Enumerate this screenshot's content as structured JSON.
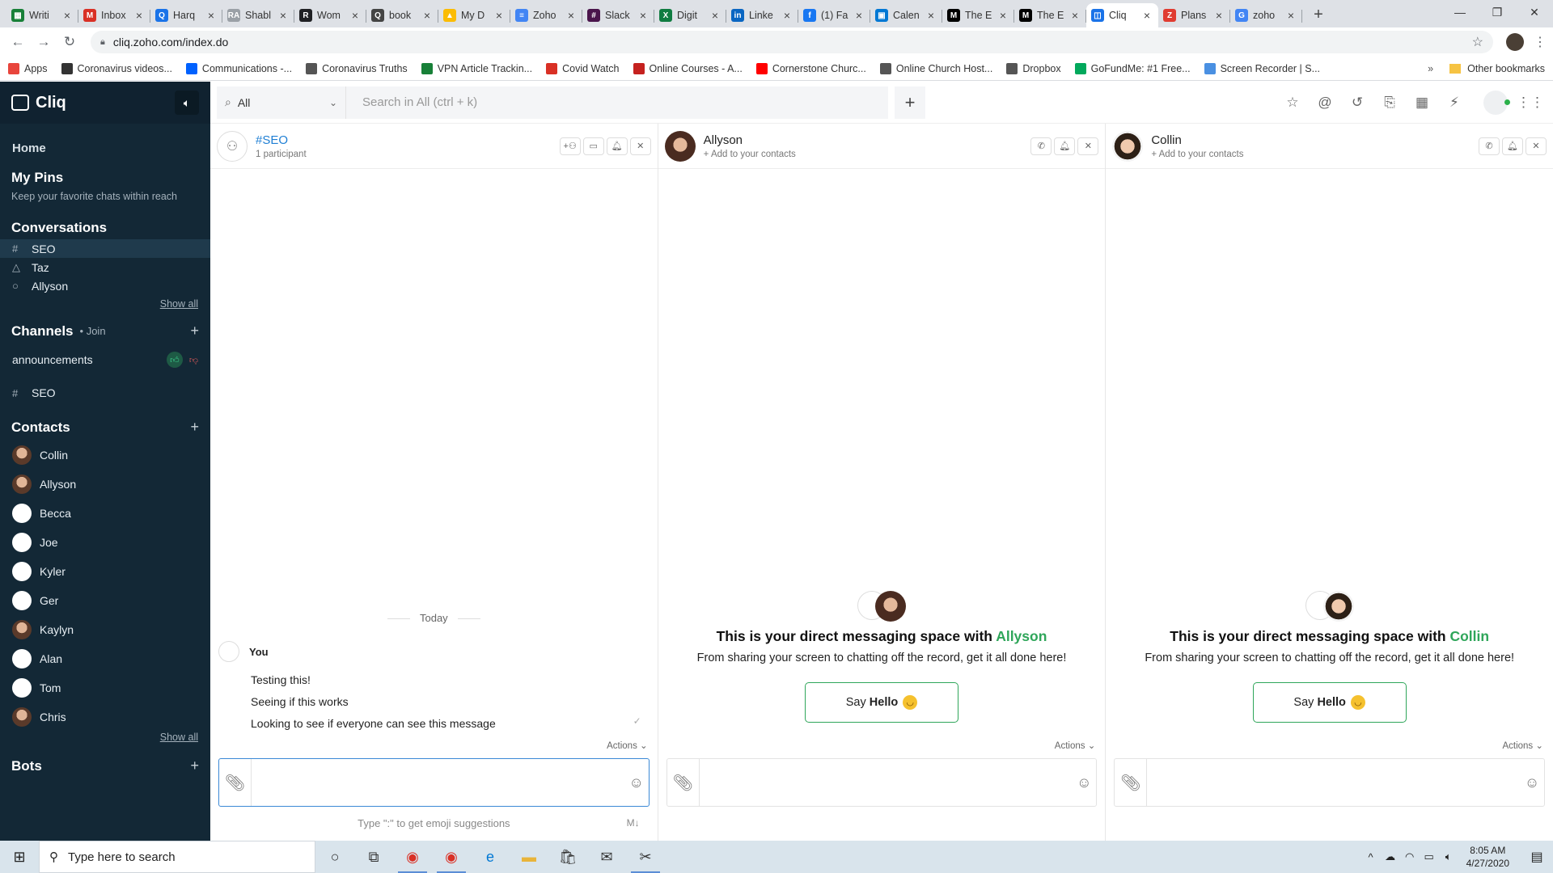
{
  "browser": {
    "tabs": [
      {
        "label": "Writi",
        "icon": "google-sheets-icon",
        "color": "#188038",
        "glyph": "▦",
        "active": false
      },
      {
        "label": "Inbox",
        "icon": "gmail-icon",
        "color": "#d93025",
        "glyph": "M",
        "active": false
      },
      {
        "label": "Harq",
        "icon": "search-icon",
        "color": "#1a73e8",
        "glyph": "Q",
        "active": false
      },
      {
        "label": "Shabl",
        "icon": "site-icon",
        "color": "#9aa0a6",
        "glyph": "RA",
        "active": false
      },
      {
        "label": "Wom",
        "icon": "r-logo-icon",
        "color": "#202124",
        "glyph": "R",
        "active": false
      },
      {
        "label": "book",
        "icon": "search-icon",
        "color": "#444444",
        "glyph": "Q",
        "active": false
      },
      {
        "label": "My D",
        "icon": "google-drive-icon",
        "color": "#fbbc04",
        "glyph": "▲",
        "active": false
      },
      {
        "label": "Zoho",
        "icon": "google-docs-icon",
        "color": "#4285f4",
        "glyph": "≡",
        "active": false
      },
      {
        "label": "Slack",
        "icon": "slack-icon",
        "color": "#4a154b",
        "glyph": "#",
        "active": false
      },
      {
        "label": "Digit",
        "icon": "excel-icon",
        "color": "#107c41",
        "glyph": "X",
        "active": false
      },
      {
        "label": "Linke",
        "icon": "linkedin-icon",
        "color": "#0a66c2",
        "glyph": "in",
        "active": false
      },
      {
        "label": "(1) Fa",
        "icon": "facebook-icon",
        "color": "#1877f2",
        "glyph": "f",
        "active": false
      },
      {
        "label": "Calen",
        "icon": "outlook-icon",
        "color": "#0078d4",
        "glyph": "▣",
        "active": false
      },
      {
        "label": "The E",
        "icon": "medium-icon",
        "color": "#000000",
        "glyph": "M",
        "active": false
      },
      {
        "label": "The E",
        "icon": "medium-icon",
        "color": "#000000",
        "glyph": "M",
        "active": false
      },
      {
        "label": "Cliq",
        "icon": "cliq-icon",
        "color": "#1a73e8",
        "glyph": "◫",
        "active": true
      },
      {
        "label": "Plans",
        "icon": "zoho-z-icon",
        "color": "#e03c31",
        "glyph": "Z",
        "active": false
      },
      {
        "label": "zoho",
        "icon": "google-icon",
        "color": "#4285f4",
        "glyph": "G",
        "active": false
      }
    ],
    "url": "cliq.zoho.com/index.do",
    "bookmarks": [
      {
        "label": "Apps",
        "color": "#e8453c"
      },
      {
        "label": "Coronavirus videos...",
        "color": "#333333"
      },
      {
        "label": "Communications -...",
        "color": "#0061fe"
      },
      {
        "label": "Coronavirus Truths",
        "color": "#555555"
      },
      {
        "label": "VPN Article Trackin...",
        "color": "#188038"
      },
      {
        "label": "Covid Watch",
        "color": "#d93025"
      },
      {
        "label": "Online Courses - A...",
        "color": "#c5221f"
      },
      {
        "label": "Cornerstone Churc...",
        "color": "#ff0000"
      },
      {
        "label": "Online Church Host...",
        "color": "#555555"
      },
      {
        "label": "Dropbox",
        "color": "#555555"
      },
      {
        "label": "GoFundMe: #1 Free...",
        "color": "#02a95c"
      },
      {
        "label": "Screen Recorder | S...",
        "color": "#4a90e2"
      }
    ],
    "other_bookmarks": "Other bookmarks"
  },
  "sidebar": {
    "app_name": "Cliq",
    "home": "Home",
    "pins_title": "My Pins",
    "pins_sub": "Keep your favorite chats within reach",
    "conversations_title": "Conversations",
    "conversations": [
      {
        "icon": "#",
        "label": "SEO",
        "selected": true
      },
      {
        "icon": "△",
        "label": "Taz",
        "selected": false
      },
      {
        "icon": "○",
        "label": "Allyson",
        "selected": false
      }
    ],
    "show_all": "Show all",
    "channels_title": "Channels",
    "channels_join": "• Join",
    "announcements": "announcements",
    "channel_seo": "SEO",
    "contacts_title": "Contacts",
    "contacts": [
      {
        "name": "Collin",
        "photo": true
      },
      {
        "name": "Allyson",
        "photo": true
      },
      {
        "name": "Becca",
        "photo": false
      },
      {
        "name": "Joe",
        "photo": false
      },
      {
        "name": "Kyler",
        "photo": false
      },
      {
        "name": "Ger",
        "photo": false
      },
      {
        "name": "Kaylyn",
        "photo": true
      },
      {
        "name": "Alan",
        "photo": false
      },
      {
        "name": "Tom",
        "photo": false
      },
      {
        "name": "Chris",
        "photo": true
      }
    ],
    "bots_title": "Bots"
  },
  "topbar": {
    "scope": "All",
    "search_placeholder": "Search in All (ctrl + k)"
  },
  "panes": {
    "seo": {
      "name": "#SEO",
      "sub": "1 participant",
      "date_divider": "Today",
      "author": "You",
      "messages": [
        "Testing this!",
        "Seeing if this works",
        "Looking to see if everyone can see this message"
      ],
      "actions": "Actions",
      "hint": "Type \":\" to get emoji suggestions",
      "md": "M↓"
    },
    "allyson": {
      "name": "Allyson",
      "sub": "+ Add to your contacts",
      "welcome_prefix": "This is your direct messaging space with ",
      "welcome_name": "Allyson",
      "welcome_sub": "From sharing your screen to chatting off the record, get it all done here!",
      "say": "Say",
      "hello": "Hello",
      "actions": "Actions"
    },
    "collin": {
      "name": "Collin",
      "sub": "+ Add to your contacts",
      "welcome_prefix": "This is your direct messaging space with ",
      "welcome_name": "Collin",
      "welcome_sub": "From sharing your screen to chatting off the record, get it all done here!",
      "say": "Say",
      "hello": "Hello",
      "actions": "Actions"
    }
  },
  "taskbar": {
    "search_placeholder": "Type here to search",
    "time": "8:05 AM",
    "date": "4/27/2020"
  },
  "colors": {
    "sidebar_bg": "#132836",
    "accent_green": "#2fa65a",
    "link_blue": "#1f7fd4"
  }
}
